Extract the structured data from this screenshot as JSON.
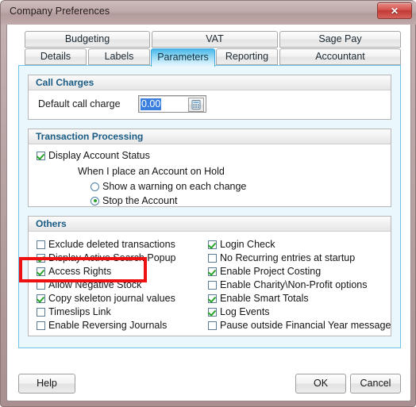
{
  "window": {
    "title": "Company Preferences",
    "close_label": "✕",
    "close_icon": "close-icon"
  },
  "tabs": {
    "row1": [
      {
        "label": "Budgeting",
        "selected": false
      },
      {
        "label": "VAT",
        "selected": false
      },
      {
        "label": "Sage Pay",
        "selected": false
      }
    ],
    "row2": [
      {
        "label": "Details",
        "selected": false
      },
      {
        "label": "Labels",
        "selected": false
      },
      {
        "label": "Parameters",
        "selected": true
      },
      {
        "label": "Reporting",
        "selected": false
      },
      {
        "label": "Accountant",
        "selected": false
      }
    ]
  },
  "call_charges": {
    "header": "Call Charges",
    "default_call_charge_label": "Default call charge",
    "default_call_charge_value": "0.00",
    "calculator_icon": "calculator-icon"
  },
  "transaction_processing": {
    "header": "Transaction Processing",
    "display_account_status": {
      "label": "Display Account Status",
      "checked": true
    },
    "hold_prompt": "When I place an Account on Hold",
    "hold_options": [
      {
        "label": "Show a warning on each change",
        "selected": false
      },
      {
        "label": "Stop the Account",
        "selected": true
      }
    ]
  },
  "others": {
    "header": "Others",
    "left_column": [
      {
        "label": "Exclude deleted transactions",
        "checked": false
      },
      {
        "label": "Display Active Search Popup",
        "checked": true
      },
      {
        "label": "Access Rights",
        "checked": true
      },
      {
        "label": "Allow Negative Stock",
        "checked": false
      },
      {
        "label": "Copy skeleton journal values",
        "checked": true
      },
      {
        "label": "Timeslips Link",
        "checked": false
      },
      {
        "label": "Enable Reversing Journals",
        "checked": false
      }
    ],
    "right_column": [
      {
        "label": "Login Check",
        "checked": true
      },
      {
        "label": "No Recurring entries at startup",
        "checked": false
      },
      {
        "label": "Enable Project Costing",
        "checked": true
      },
      {
        "label": "Enable Charity\\Non-Profit options",
        "checked": false
      },
      {
        "label": "Enable Smart Totals",
        "checked": true
      },
      {
        "label": "Log Events",
        "checked": true
      },
      {
        "label": "Pause outside Financial Year message",
        "checked": false
      }
    ]
  },
  "annotation": {
    "target": "Access Rights",
    "color": "#ee1111"
  },
  "footer": {
    "help_label": "Help",
    "ok_label": "OK",
    "cancel_label": "Cancel"
  }
}
